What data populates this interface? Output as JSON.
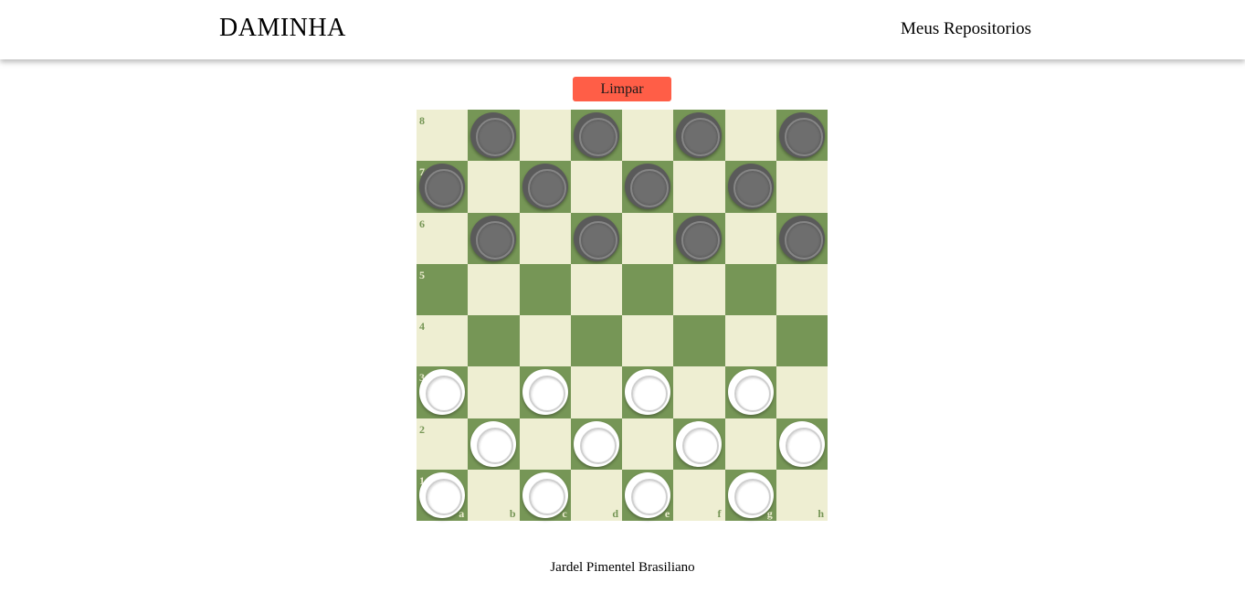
{
  "header": {
    "brand": "DAMINHA",
    "nav_link": "Meus Repositorios"
  },
  "controls": {
    "clear_label": "Limpar"
  },
  "board": {
    "ranks": [
      "8",
      "7",
      "6",
      "5",
      "4",
      "3",
      "2",
      "1"
    ],
    "files": [
      "a",
      "b",
      "c",
      "d",
      "e",
      "f",
      "g",
      "h"
    ],
    "light_color": "#eeeed2",
    "dark_color": "#769656",
    "pieces": [
      {
        "square": "b8",
        "color": "black"
      },
      {
        "square": "d8",
        "color": "black"
      },
      {
        "square": "f8",
        "color": "black"
      },
      {
        "square": "h8",
        "color": "black"
      },
      {
        "square": "a7",
        "color": "black"
      },
      {
        "square": "c7",
        "color": "black"
      },
      {
        "square": "e7",
        "color": "black"
      },
      {
        "square": "g7",
        "color": "black"
      },
      {
        "square": "b6",
        "color": "black"
      },
      {
        "square": "d6",
        "color": "black"
      },
      {
        "square": "f6",
        "color": "black"
      },
      {
        "square": "h6",
        "color": "black"
      },
      {
        "square": "a3",
        "color": "white"
      },
      {
        "square": "c3",
        "color": "white"
      },
      {
        "square": "e3",
        "color": "white"
      },
      {
        "square": "g3",
        "color": "white"
      },
      {
        "square": "b2",
        "color": "white"
      },
      {
        "square": "d2",
        "color": "white"
      },
      {
        "square": "f2",
        "color": "white"
      },
      {
        "square": "h2",
        "color": "white"
      },
      {
        "square": "a1",
        "color": "white"
      },
      {
        "square": "c1",
        "color": "white"
      },
      {
        "square": "e1",
        "color": "white"
      },
      {
        "square": "g1",
        "color": "white"
      }
    ]
  },
  "footer": {
    "author": "Jardel Pimentel Brasiliano"
  },
  "colors": {
    "accent": "#ff5e47"
  }
}
